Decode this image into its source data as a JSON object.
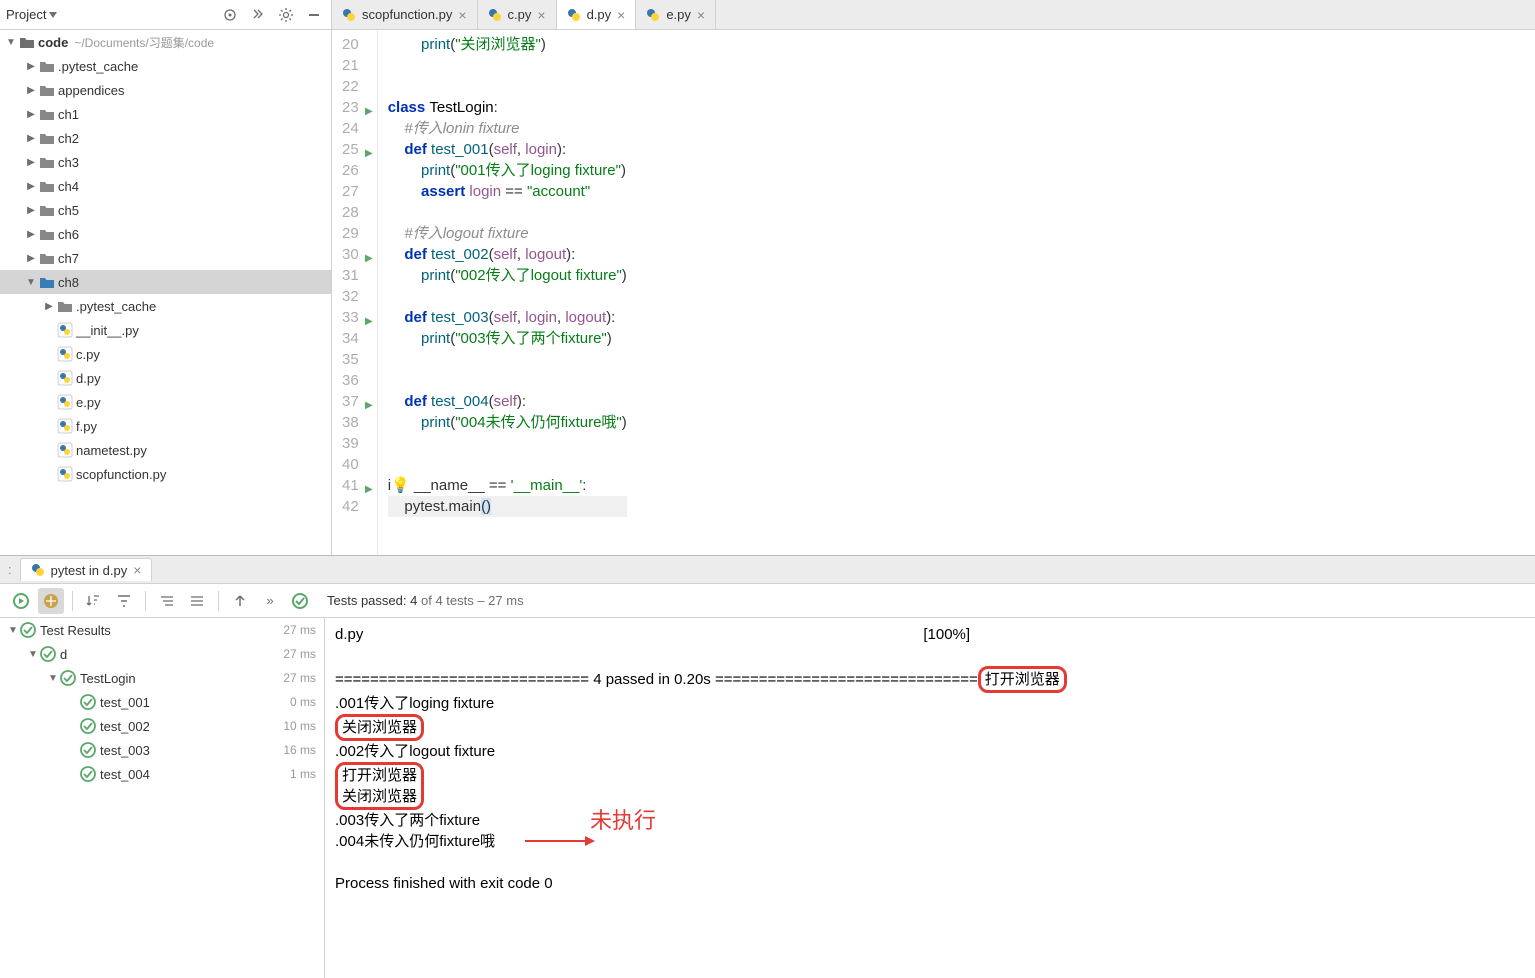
{
  "project": {
    "title": "Project",
    "root": {
      "label": "code",
      "path": "~/Documents/习题集/code"
    },
    "items": [
      {
        "label": ".pytest_cache",
        "depth": 1,
        "type": "folder",
        "expanded": false
      },
      {
        "label": "appendices",
        "depth": 1,
        "type": "folder",
        "expanded": false
      },
      {
        "label": "ch1",
        "depth": 1,
        "type": "folder",
        "expanded": false
      },
      {
        "label": "ch2",
        "depth": 1,
        "type": "folder",
        "expanded": false
      },
      {
        "label": "ch3",
        "depth": 1,
        "type": "folder",
        "expanded": false
      },
      {
        "label": "ch4",
        "depth": 1,
        "type": "folder",
        "expanded": false
      },
      {
        "label": "ch5",
        "depth": 1,
        "type": "folder",
        "expanded": false
      },
      {
        "label": "ch6",
        "depth": 1,
        "type": "folder",
        "expanded": false
      },
      {
        "label": "ch7",
        "depth": 1,
        "type": "folder",
        "expanded": false
      },
      {
        "label": "ch8",
        "depth": 1,
        "type": "folder",
        "expanded": true,
        "selected": true
      },
      {
        "label": ".pytest_cache",
        "depth": 2,
        "type": "folder",
        "expanded": false
      },
      {
        "label": "__init__.py",
        "depth": 2,
        "type": "py"
      },
      {
        "label": "c.py",
        "depth": 2,
        "type": "py"
      },
      {
        "label": "d.py",
        "depth": 2,
        "type": "py"
      },
      {
        "label": "e.py",
        "depth": 2,
        "type": "py"
      },
      {
        "label": "f.py",
        "depth": 2,
        "type": "py"
      },
      {
        "label": "nametest.py",
        "depth": 2,
        "type": "py"
      },
      {
        "label": "scopfunction.py",
        "depth": 2,
        "type": "py"
      }
    ]
  },
  "editor": {
    "tabs": [
      {
        "label": "scopfunction.py",
        "active": false
      },
      {
        "label": "c.py",
        "active": false
      },
      {
        "label": "d.py",
        "active": true
      },
      {
        "label": "e.py",
        "active": false
      }
    ],
    "first_line_no": 20,
    "line_count": 23
  },
  "run": {
    "tab_label": "pytest in d.py",
    "summary_pre": "Tests passed:",
    "summary_count": "4",
    "summary_mid": "of 4 tests – 27 ms",
    "tree": {
      "root": {
        "label": "Test Results",
        "time": "27 ms"
      },
      "nodes": [
        {
          "label": "d",
          "depth": 1,
          "time": "27 ms",
          "expandable": true
        },
        {
          "label": "TestLogin",
          "depth": 2,
          "time": "27 ms",
          "expandable": true
        },
        {
          "label": "test_001",
          "depth": 3,
          "time": "0 ms"
        },
        {
          "label": "test_002",
          "depth": 3,
          "time": "10 ms"
        },
        {
          "label": "test_003",
          "depth": 3,
          "time": "16 ms"
        },
        {
          "label": "test_004",
          "depth": 3,
          "time": "1 ms"
        }
      ]
    },
    "console": {
      "l1a": "d.py",
      "l1b": "[100%]",
      "l2a": "============================= 4 passed in 0.20s ==============================",
      "l2_box": "打开浏览器",
      "l3": ".001传入了loging fixture",
      "l4_box": "关闭浏览器",
      "l5": ".002传入了logout fixture",
      "l6a": "打开浏览器",
      "l6b": "关闭浏览器",
      "l7": ".003传入了两个fixture",
      "l8": ".004未传入仍何fixture哦",
      "annot": "未执行",
      "exit": "Process finished with exit code 0"
    }
  }
}
